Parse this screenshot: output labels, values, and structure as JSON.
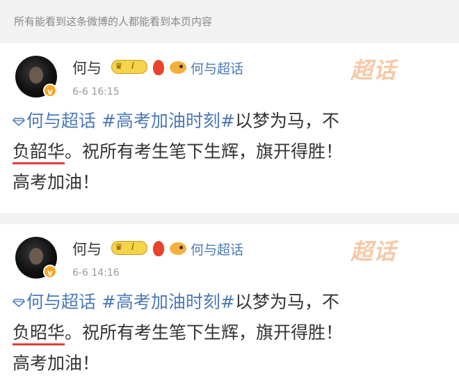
{
  "notice": "所有能看到这条微博的人都能看到本页内容",
  "posts": [
    {
      "name": "何与",
      "level": "I",
      "topic": "何与超话",
      "time": "6-6 16:15",
      "watermark": "超话",
      "line1_topic": "何与超话",
      "line1_tag": "#高考加油时刻#",
      "line1_text": "以梦为马，不",
      "line2_underlined": "负韶华",
      "line2_text": "。祝所有考生笔下生辉，旗开得胜！",
      "line3_text": "高考加油！"
    },
    {
      "name": "何与",
      "level": "I",
      "topic": "何与超话",
      "time": "6-6 14:16",
      "watermark": "超话",
      "line1_topic": "何与超话",
      "line1_tag": "#高考加油时刻#",
      "line1_text": "以梦为马，不",
      "line2_underlined": "负昭华",
      "line2_text": "。祝所有考生笔下生辉，旗开得胜！",
      "line3_text": "高考加油！"
    }
  ],
  "colors": {
    "link": "#4a79b6",
    "underline": "#e23c3c",
    "watermark": "#f7c8a6"
  },
  "icons": [
    "avatar",
    "v-badge-icon",
    "crown-level-icon",
    "fire-icon",
    "fish-icon",
    "diamond-icon"
  ]
}
